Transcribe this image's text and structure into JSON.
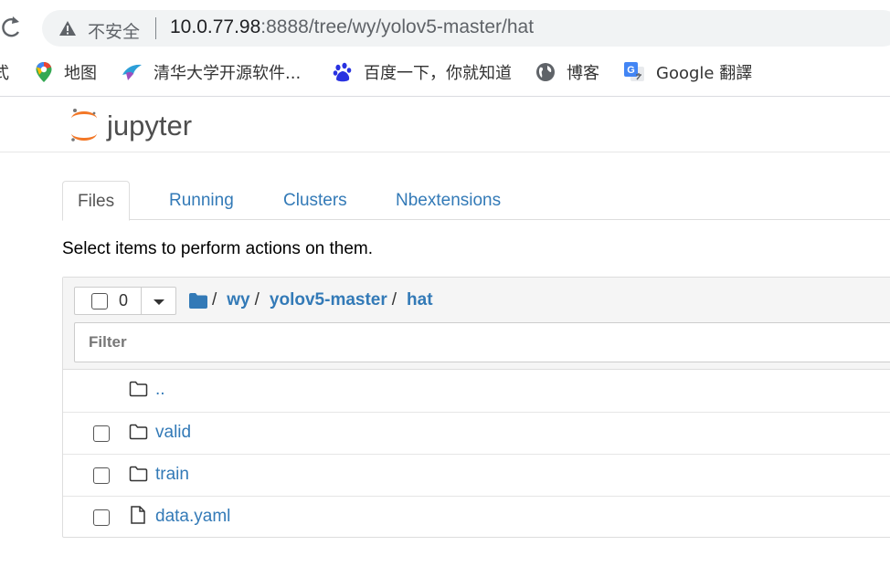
{
  "browser": {
    "insecure_label": "不安全",
    "url_host": "10.0.77.98",
    "url_rest": ":8888/tree/wy/yolov5-master/hat",
    "bookmarks": [
      {
        "label": "式",
        "icon": "partial-bookmark"
      },
      {
        "label": "地图",
        "icon": "maps-pin-icon"
      },
      {
        "label": "清华大学开源软件...",
        "icon": "tuna-bird-icon"
      },
      {
        "label": "百度一下，你就知道",
        "icon": "baidu-paw-icon"
      },
      {
        "label": "博客",
        "icon": "globe-icon"
      },
      {
        "label": "Google 翻譯",
        "icon": "google-translate-icon"
      }
    ]
  },
  "jupyter": {
    "logo_text": "jupyter",
    "tabs": [
      {
        "label": "Files",
        "active": true
      },
      {
        "label": "Running",
        "active": false
      },
      {
        "label": "Clusters",
        "active": false
      },
      {
        "label": "Nbextensions",
        "active": false
      }
    ],
    "instructions": "Select items to perform actions on them.",
    "selected_count": "0",
    "breadcrumbs": [
      "wy",
      "yolov5-master",
      "hat"
    ],
    "breadcrumb_separator": "/",
    "filter_placeholder": "Filter",
    "items": [
      {
        "name": "..",
        "type": "folder",
        "checkbox": false
      },
      {
        "name": "valid",
        "type": "folder",
        "checkbox": true
      },
      {
        "name": "train",
        "type": "folder",
        "checkbox": true
      },
      {
        "name": "data.yaml",
        "type": "file",
        "checkbox": true
      }
    ]
  },
  "colors": {
    "link": "#337ab7",
    "jupyter_orange": "#f37726",
    "logo_text": "#4e4e4e"
  }
}
